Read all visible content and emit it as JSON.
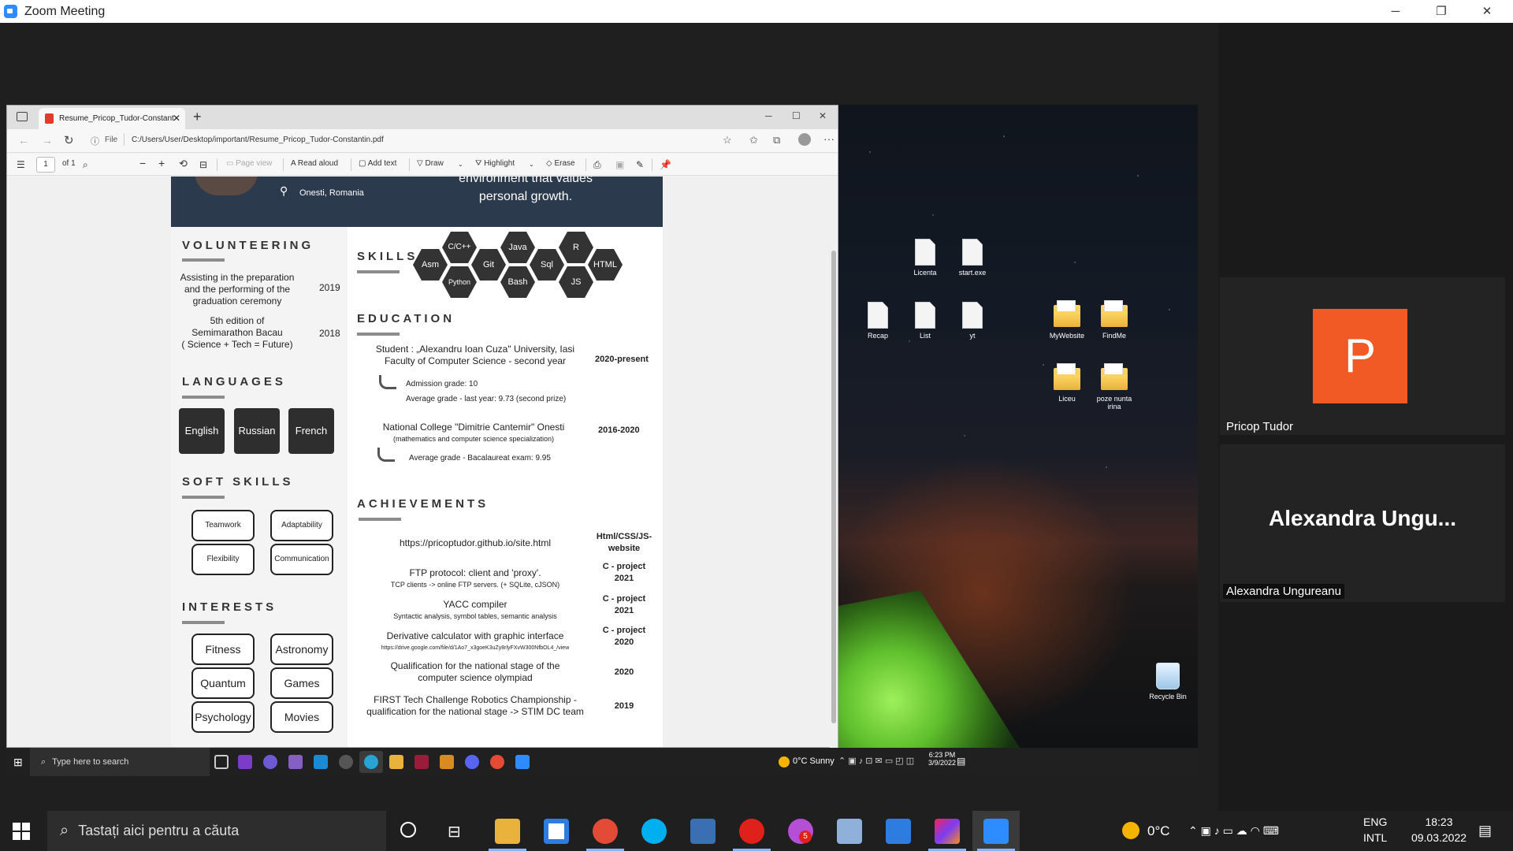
{
  "zoom": {
    "title": "Zoom Meeting",
    "controls": {
      "minimize": "─",
      "restore": "❐",
      "close": "✕"
    }
  },
  "edge": {
    "tab_title": "Resume_Pricop_Tudor-Constant",
    "close_tab": "✕",
    "new_tab": "+",
    "address_label": "File",
    "url": "C:/Users/User/Desktop/important/Resume_Pricop_Tudor-Constantin.pdf",
    "page_number": "1",
    "page_total": "of 1",
    "toolbar": {
      "page_view": "Page view",
      "read_aloud": "Read aloud",
      "add_text": "Add text",
      "draw": "Draw",
      "highlight": "Highlight",
      "erase": "Erase"
    }
  },
  "resume": {
    "header": {
      "location": "Onesti, Romania",
      "tagline_1": "environment that values",
      "tagline_2": "personal growth."
    },
    "volunteering": {
      "title": "VOLUNTEERING",
      "items": [
        {
          "text_1": "Assisting in the preparation",
          "text_2": "and the performing of the",
          "text_3": "graduation ceremony",
          "year": "2019"
        },
        {
          "text_1": "5th edition of",
          "text_2": "Semimarathon Bacau",
          "text_3": "( Science + Tech = Future)",
          "year": "2018"
        }
      ]
    },
    "languages": {
      "title": "LANGUAGES",
      "items": [
        "English",
        "Russian",
        "French"
      ]
    },
    "soft_skills": {
      "title": "SOFT SKILLS",
      "items": [
        "Teamwork",
        "Adaptability",
        "Flexibility",
        "Communication"
      ]
    },
    "interests": {
      "title": "INTERESTS",
      "items": [
        "Fitness",
        "Astronomy",
        "Quantum",
        "Games",
        "Psychology",
        "Movies"
      ]
    },
    "skills": {
      "title": "SKILLS",
      "items": [
        "C/C++",
        "Java",
        "R",
        "Asm",
        "Git",
        "Sql",
        "HTML",
        "Python",
        "Bash",
        "JS"
      ]
    },
    "education": {
      "title": "EDUCATION",
      "entries": [
        {
          "line_1": "Student : „Alexandru Ioan Cuza\" University, Iasi",
          "line_2": "Faculty of Computer Science - second year",
          "years": "2020-present",
          "detail_1": "Admission grade:  10",
          "detail_2": "Average grade - last year:  9.73 (second prize)"
        },
        {
          "line_1": "National College \"Dimitrie Cantemir\" Onesti",
          "line_2": "(mathematics and computer science specialization)",
          "years": "2016-2020",
          "detail_1": "Average grade - Bacalaureat exam:  9.95"
        }
      ]
    },
    "achievements": {
      "title": "ACHIEVEMENTS",
      "items": [
        {
          "text": "https://pricoptudor.github.io/site.html",
          "sub": "",
          "tag_1": "Html/CSS/JS-",
          "tag_2": "website"
        },
        {
          "text": "FTP protocol: client and 'proxy'.",
          "sub": "TCP clients -> online FTP servers. (+ SQLite, cJSON)",
          "tag_1": "C - project",
          "tag_2": "2021"
        },
        {
          "text": "YACC compiler",
          "sub": "Syntactic analysis, symbol tables, semantic analysis",
          "tag_1": "C - project",
          "tag_2": "2021"
        },
        {
          "text": "Derivative calculator with graphic interface",
          "sub": "https://drive.google.com/file/d/1Ao7_x3goeK3uZy8rlyFXvW300NfbOL4_/view",
          "tag_1": "C - project",
          "tag_2": "2020"
        },
        {
          "text": "Qualification for the national stage of the",
          "sub": "computer science olympiad",
          "tag_1": "2020",
          "tag_2": ""
        },
        {
          "text": "FIRST Tech Challenge Robotics Championship -",
          "sub": "qualification for the national stage -> STIM DC team",
          "tag_1": "2019",
          "tag_2": ""
        }
      ]
    }
  },
  "remote_desktop": {
    "icons": [
      "Licenta",
      "start.exe",
      "Recap",
      "List",
      "yt",
      "MyWebsite",
      "FindMe",
      "Liceu",
      "poze nunta irina",
      "Recycle Bin"
    ],
    "taskbar": {
      "search_placeholder": "Type here to search",
      "weather": "0°C  Sunny",
      "time": "6:23 PM",
      "date": "3/9/2022"
    }
  },
  "participants": [
    {
      "initial": "P",
      "name": "Pricop Tudor",
      "avatar_color": "#f15a24"
    },
    {
      "big_name": "Alexandra  Ungu...",
      "name": "Alexandra Ungureanu"
    }
  ],
  "taskbar": {
    "search_placeholder": "Tastați aici pentru a căuta",
    "weather": "0°C",
    "language_1": "ENG",
    "language_2": "INTL",
    "time": "18:23",
    "date": "09.03.2022",
    "opera_badge": "5"
  }
}
